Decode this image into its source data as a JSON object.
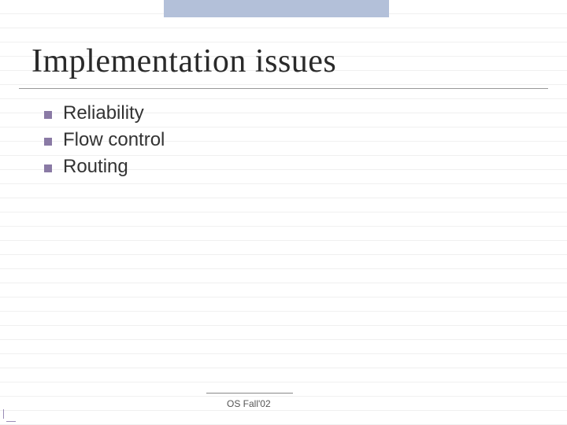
{
  "title": "Implementation issues",
  "bullets": [
    "Reliability",
    "Flow control",
    "Routing"
  ],
  "footer": "OS Fall'02"
}
